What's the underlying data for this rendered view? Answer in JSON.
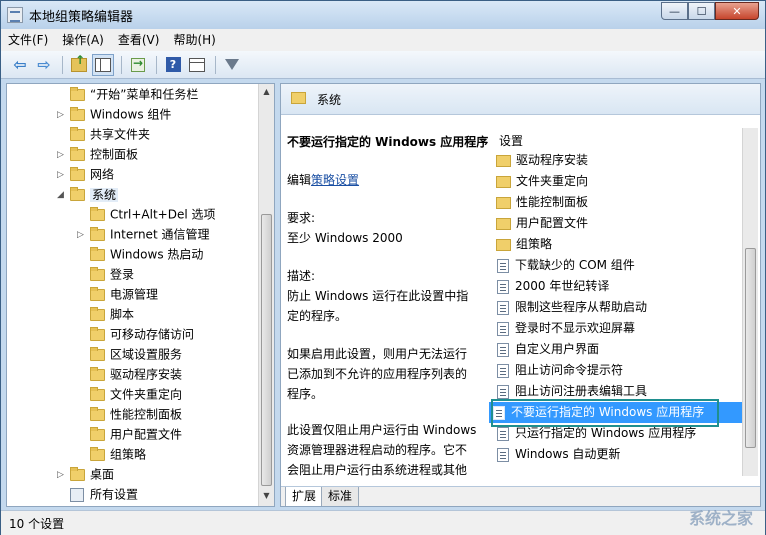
{
  "window": {
    "title": "本地组策略编辑器",
    "minimize": "—",
    "maximize": "☐",
    "close": "✕"
  },
  "menu": [
    "文件(F)",
    "操作(A)",
    "查看(V)",
    "帮助(H)"
  ],
  "tree": [
    {
      "label": "“开始”菜单和任务栏",
      "expander": ""
    },
    {
      "label": "Windows 组件",
      "expander": "▷"
    },
    {
      "label": "共享文件夹",
      "expander": ""
    },
    {
      "label": "控制面板",
      "expander": "▷"
    },
    {
      "label": "网络",
      "expander": "▷"
    },
    {
      "label": "系统",
      "expander": "◢"
    },
    {
      "label": "Ctrl+Alt+Del 选项",
      "expander": ""
    },
    {
      "label": "Internet 通信管理",
      "expander": "▷"
    },
    {
      "label": "Windows 热启动",
      "expander": ""
    },
    {
      "label": "登录",
      "expander": ""
    },
    {
      "label": "电源管理",
      "expander": ""
    },
    {
      "label": "脚本",
      "expander": ""
    },
    {
      "label": "可移动存储访问",
      "expander": ""
    },
    {
      "label": "区域设置服务",
      "expander": ""
    },
    {
      "label": "驱动程序安装",
      "expander": ""
    },
    {
      "label": "文件夹重定向",
      "expander": ""
    },
    {
      "label": "性能控制面板",
      "expander": ""
    },
    {
      "label": "用户配置文件",
      "expander": ""
    },
    {
      "label": "组策略",
      "expander": ""
    },
    {
      "label": "桌面",
      "expander": "▷"
    },
    {
      "label": "所有设置",
      "expander": ""
    }
  ],
  "right": {
    "header": "系统",
    "desc_title": "不要运行指定的 Windows 应用程序",
    "edit_prefix": "编辑",
    "edit_link": "策略设置",
    "req_label": "要求:",
    "req_value": "至少 Windows 2000",
    "desc_label": "描述:",
    "desc_p1": "防止 Windows 运行在此设置中指定的程序。",
    "desc_p2": "如果启用此设置，则用户无法运行已添加到不允许的应用程序列表的程序。",
    "desc_p3": "此设置仅阻止用户运行由 Windows 资源管理器进程启动的程序。它不会阻止用户运行由系统进程或其他进程启动的程序，如任",
    "list_header": "设置",
    "list": [
      {
        "label": "驱动程序安装",
        "kind": "folder"
      },
      {
        "label": "文件夹重定向",
        "kind": "folder"
      },
      {
        "label": "性能控制面板",
        "kind": "folder"
      },
      {
        "label": "用户配置文件",
        "kind": "folder"
      },
      {
        "label": "组策略",
        "kind": "folder"
      },
      {
        "label": "下载缺少的 COM 组件",
        "kind": "setting"
      },
      {
        "label": "2000 年世纪转译",
        "kind": "setting"
      },
      {
        "label": "限制这些程序从帮助启动",
        "kind": "setting"
      },
      {
        "label": "登录时不显示欢迎屏幕",
        "kind": "setting"
      },
      {
        "label": "自定义用户界面",
        "kind": "setting"
      },
      {
        "label": "阻止访问命令提示符",
        "kind": "setting"
      },
      {
        "label": "阻止访问注册表编辑工具",
        "kind": "setting"
      },
      {
        "label": "不要运行指定的 Windows 应用程序",
        "kind": "setting"
      },
      {
        "label": "只运行指定的 Windows 应用程序",
        "kind": "setting"
      },
      {
        "label": "Windows 自动更新",
        "kind": "setting"
      }
    ],
    "tabs": [
      "扩展",
      "标准"
    ]
  },
  "status": "10 个设置",
  "watermark": "系统之家"
}
